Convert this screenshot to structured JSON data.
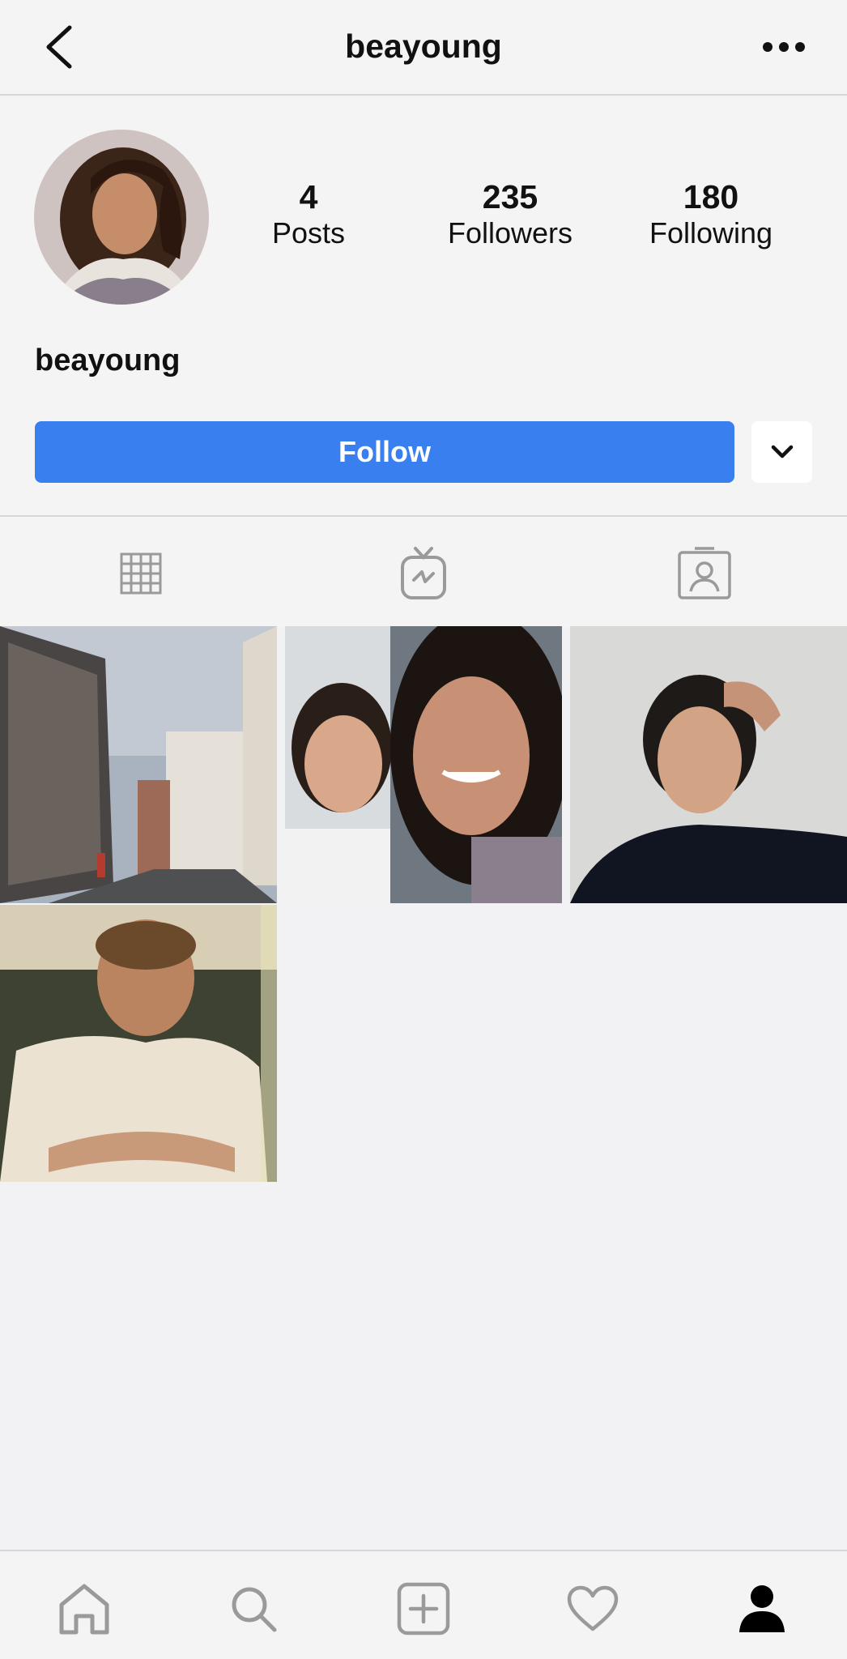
{
  "header": {
    "username": "beayoung",
    "back_icon": "chevron-left-icon",
    "more_icon": "more-horizontal-icon"
  },
  "profile": {
    "username": "beayoung",
    "stats": {
      "posts": {
        "value": "4",
        "label": "Posts"
      },
      "followers": {
        "value": "235",
        "label": "Followers"
      },
      "following": {
        "value": "180",
        "label": "Following"
      }
    },
    "follow_label": "Follow",
    "dropdown_icon": "chevron-down-icon"
  },
  "tabs": [
    "grid-icon",
    "igtv-icon",
    "tagged-icon"
  ],
  "posts": [
    {
      "kind": "street-photo"
    },
    {
      "kind": "selfie-photo"
    },
    {
      "kind": "portrait-photo"
    },
    {
      "kind": "seated-portrait-photo"
    }
  ],
  "bottom_nav": [
    "home-icon",
    "search-icon",
    "new-post-icon",
    "activity-heart-icon",
    "profile-icon"
  ],
  "colors": {
    "accent": "#3a7ff0",
    "background": "#f2f2f5",
    "icon_gray": "#9a9a9a"
  }
}
